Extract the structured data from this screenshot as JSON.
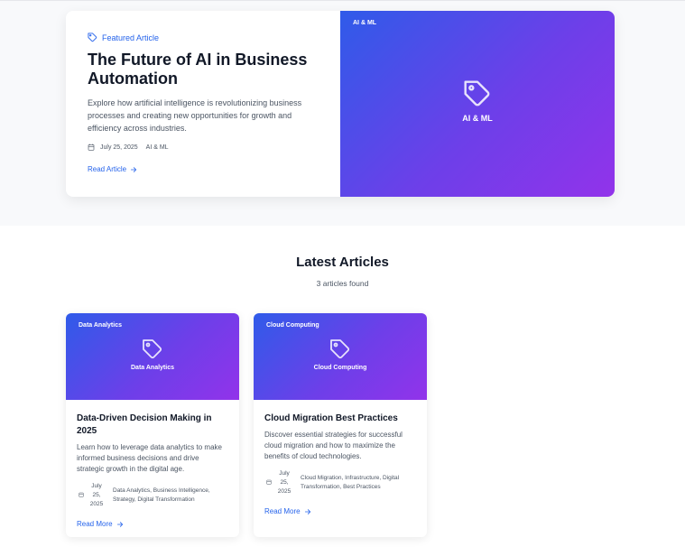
{
  "featured": {
    "tag_label": "Featured Article",
    "title": "The Future of AI in Business Automation",
    "description": "Explore how artificial intelligence is revolutionizing business processes and creating new opportunities for growth and efficiency across industries.",
    "date": "July 25, 2025",
    "category": "AI & ML",
    "link_label": "Read Article",
    "image_badge": "AI & ML",
    "image_label": "AI & ML"
  },
  "latest": {
    "title": "Latest Articles",
    "count_text": "3 articles found"
  },
  "articles": [
    {
      "badge": "Data Analytics",
      "image_label": "Data Analytics",
      "title": "Data-Driven Decision Making in 2025",
      "description": "Learn how to leverage data analytics to make informed business decisions and drive strategic growth in the digital age.",
      "date_line1": "July",
      "date_line2": "25,",
      "date_line3": "2025",
      "categories": "Data Analytics, Business Intelligence, Strategy, Digital Transformation",
      "link_label": "Read More"
    },
    {
      "badge": "Cloud Computing",
      "image_label": "Cloud Computing",
      "title": "Cloud Migration Best Practices",
      "description": "Discover essential strategies for successful cloud migration and how to maximize the benefits of cloud technologies.",
      "date_line1": "July",
      "date_line2": "25,",
      "date_line3": "2025",
      "categories": "Cloud Migration, Infrastructure, Digital Transformation, Best Practices",
      "link_label": "Read More"
    }
  ],
  "colors": {
    "accent": "#2563eb",
    "gradient_start": "#2f5be9",
    "gradient_end": "#9233ea"
  }
}
